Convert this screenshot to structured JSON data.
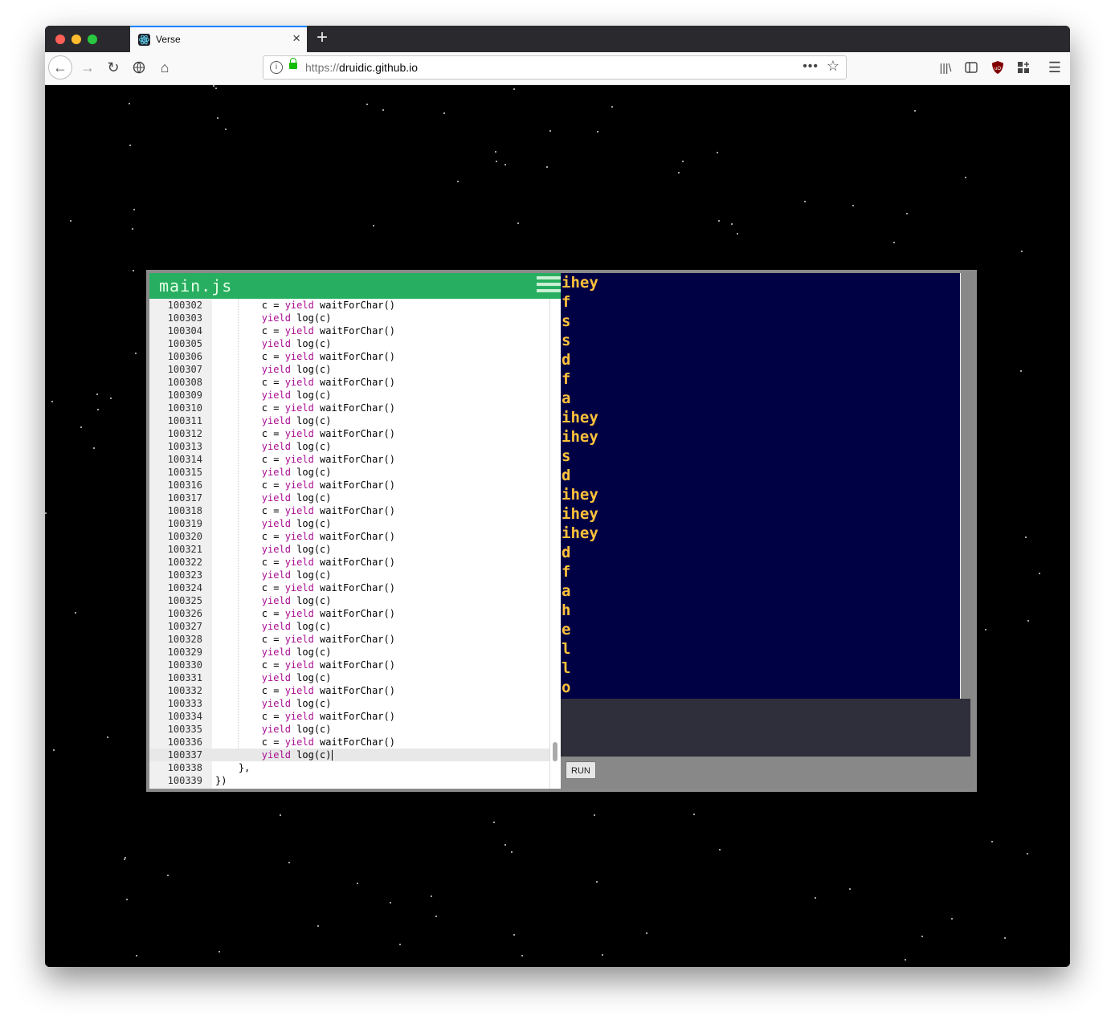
{
  "browser": {
    "tab_title": "Verse",
    "tab_close": "×",
    "new_tab": "+",
    "url_scheme": "https://",
    "url_host": "druidic.github.io",
    "url_more": "•••",
    "url_star": "☆",
    "nav": {
      "back": "←",
      "forward": "→",
      "reload": "↻",
      "home": "⌂",
      "library": "|||\\",
      "sidebar": "▯",
      "ublock": "⛊",
      "extensions": "▦",
      "menu": "☰"
    }
  },
  "editor": {
    "title": "main.js",
    "lines": [
      {
        "n": "100302",
        "indent": "        ",
        "parts": [
          [
            "c = ",
            ""
          ],
          [
            "yield",
            "kw"
          ],
          [
            " waitForChar()",
            ""
          ]
        ]
      },
      {
        "n": "100303",
        "indent": "        ",
        "parts": [
          [
            "yield",
            "kw"
          ],
          [
            " log(c)",
            ""
          ]
        ]
      },
      {
        "n": "100304",
        "indent": "        ",
        "parts": [
          [
            "c = ",
            ""
          ],
          [
            "yield",
            "kw"
          ],
          [
            " waitForChar()",
            ""
          ]
        ]
      },
      {
        "n": "100305",
        "indent": "        ",
        "parts": [
          [
            "yield",
            "kw"
          ],
          [
            " log(c)",
            ""
          ]
        ]
      },
      {
        "n": "100306",
        "indent": "        ",
        "parts": [
          [
            "c = ",
            ""
          ],
          [
            "yield",
            "kw"
          ],
          [
            " waitForChar()",
            ""
          ]
        ]
      },
      {
        "n": "100307",
        "indent": "        ",
        "parts": [
          [
            "yield",
            "kw"
          ],
          [
            " log(c)",
            ""
          ]
        ]
      },
      {
        "n": "100308",
        "indent": "        ",
        "parts": [
          [
            "c = ",
            ""
          ],
          [
            "yield",
            "kw"
          ],
          [
            " waitForChar()",
            ""
          ]
        ]
      },
      {
        "n": "100309",
        "indent": "        ",
        "parts": [
          [
            "yield",
            "kw"
          ],
          [
            " log(c)",
            ""
          ]
        ]
      },
      {
        "n": "100310",
        "indent": "        ",
        "parts": [
          [
            "c = ",
            ""
          ],
          [
            "yield",
            "kw"
          ],
          [
            " waitForChar()",
            ""
          ]
        ]
      },
      {
        "n": "100311",
        "indent": "        ",
        "parts": [
          [
            "yield",
            "kw"
          ],
          [
            " log(c)",
            ""
          ]
        ]
      },
      {
        "n": "100312",
        "indent": "        ",
        "parts": [
          [
            "c = ",
            ""
          ],
          [
            "yield",
            "kw"
          ],
          [
            " waitForChar()",
            ""
          ]
        ]
      },
      {
        "n": "100313",
        "indent": "        ",
        "parts": [
          [
            "yield",
            "kw"
          ],
          [
            " log(c)",
            ""
          ]
        ]
      },
      {
        "n": "100314",
        "indent": "        ",
        "parts": [
          [
            "c = ",
            ""
          ],
          [
            "yield",
            "kw"
          ],
          [
            " waitForChar()",
            ""
          ]
        ]
      },
      {
        "n": "100315",
        "indent": "        ",
        "parts": [
          [
            "yield",
            "kw"
          ],
          [
            " log(c)",
            ""
          ]
        ]
      },
      {
        "n": "100316",
        "indent": "        ",
        "parts": [
          [
            "c = ",
            ""
          ],
          [
            "yield",
            "kw"
          ],
          [
            " waitForChar()",
            ""
          ]
        ]
      },
      {
        "n": "100317",
        "indent": "        ",
        "parts": [
          [
            "yield",
            "kw"
          ],
          [
            " log(c)",
            ""
          ]
        ]
      },
      {
        "n": "100318",
        "indent": "        ",
        "parts": [
          [
            "c = ",
            ""
          ],
          [
            "yield",
            "kw"
          ],
          [
            " waitForChar()",
            ""
          ]
        ]
      },
      {
        "n": "100319",
        "indent": "        ",
        "parts": [
          [
            "yield",
            "kw"
          ],
          [
            " log(c)",
            ""
          ]
        ]
      },
      {
        "n": "100320",
        "indent": "        ",
        "parts": [
          [
            "c = ",
            ""
          ],
          [
            "yield",
            "kw"
          ],
          [
            " waitForChar()",
            ""
          ]
        ]
      },
      {
        "n": "100321",
        "indent": "        ",
        "parts": [
          [
            "yield",
            "kw"
          ],
          [
            " log(c)",
            ""
          ]
        ]
      },
      {
        "n": "100322",
        "indent": "        ",
        "parts": [
          [
            "c = ",
            ""
          ],
          [
            "yield",
            "kw"
          ],
          [
            " waitForChar()",
            ""
          ]
        ]
      },
      {
        "n": "100323",
        "indent": "        ",
        "parts": [
          [
            "yield",
            "kw"
          ],
          [
            " log(c)",
            ""
          ]
        ]
      },
      {
        "n": "100324",
        "indent": "        ",
        "parts": [
          [
            "c = ",
            ""
          ],
          [
            "yield",
            "kw"
          ],
          [
            " waitForChar()",
            ""
          ]
        ]
      },
      {
        "n": "100325",
        "indent": "        ",
        "parts": [
          [
            "yield",
            "kw"
          ],
          [
            " log(c)",
            ""
          ]
        ]
      },
      {
        "n": "100326",
        "indent": "        ",
        "parts": [
          [
            "c = ",
            ""
          ],
          [
            "yield",
            "kw"
          ],
          [
            " waitForChar()",
            ""
          ]
        ]
      },
      {
        "n": "100327",
        "indent": "        ",
        "parts": [
          [
            "yield",
            "kw"
          ],
          [
            " log(c)",
            ""
          ]
        ]
      },
      {
        "n": "100328",
        "indent": "        ",
        "parts": [
          [
            "c = ",
            ""
          ],
          [
            "yield",
            "kw"
          ],
          [
            " waitForChar()",
            ""
          ]
        ]
      },
      {
        "n": "100329",
        "indent": "        ",
        "parts": [
          [
            "yield",
            "kw"
          ],
          [
            " log(c)",
            ""
          ]
        ]
      },
      {
        "n": "100330",
        "indent": "        ",
        "parts": [
          [
            "c = ",
            ""
          ],
          [
            "yield",
            "kw"
          ],
          [
            " waitForChar()",
            ""
          ]
        ]
      },
      {
        "n": "100331",
        "indent": "        ",
        "parts": [
          [
            "yield",
            "kw"
          ],
          [
            " log(c)",
            ""
          ]
        ]
      },
      {
        "n": "100332",
        "indent": "        ",
        "parts": [
          [
            "c = ",
            ""
          ],
          [
            "yield",
            "kw"
          ],
          [
            " waitForChar()",
            ""
          ]
        ]
      },
      {
        "n": "100333",
        "indent": "        ",
        "parts": [
          [
            "yield",
            "kw"
          ],
          [
            " log(c)",
            ""
          ]
        ]
      },
      {
        "n": "100334",
        "indent": "        ",
        "parts": [
          [
            "c = ",
            ""
          ],
          [
            "yield",
            "kw"
          ],
          [
            " waitForChar()",
            ""
          ]
        ]
      },
      {
        "n": "100335",
        "indent": "        ",
        "parts": [
          [
            "yield",
            "kw"
          ],
          [
            " log(c)",
            ""
          ]
        ]
      },
      {
        "n": "100336",
        "indent": "        ",
        "parts": [
          [
            "c = ",
            ""
          ],
          [
            "yield",
            "kw"
          ],
          [
            " waitForChar()",
            ""
          ]
        ]
      },
      {
        "n": "100337",
        "indent": "        ",
        "parts": [
          [
            "yield",
            "kw"
          ],
          [
            " log(c)",
            ""
          ]
        ],
        "active": true
      },
      {
        "n": "100338",
        "indent": "    ",
        "parts": [
          [
            "},",
            ""
          ]
        ]
      },
      {
        "n": "100339",
        "indent": "",
        "parts": [
          [
            "})",
            ""
          ]
        ]
      }
    ]
  },
  "output": {
    "lines": [
      "ihey",
      "f",
      "s",
      "s",
      "d",
      "f",
      "a",
      "ihey",
      "ihey",
      "s",
      "d",
      "ihey",
      "ihey",
      "ihey",
      "d",
      "f",
      "a",
      "h",
      "e",
      "l",
      "l",
      "o"
    ]
  },
  "controls": {
    "run_label": "RUN"
  },
  "colors": {
    "editor_header": "#27ae60",
    "output_bg": "#000045",
    "output_text": "#ffc23a",
    "keyword": "#aa0d91"
  }
}
